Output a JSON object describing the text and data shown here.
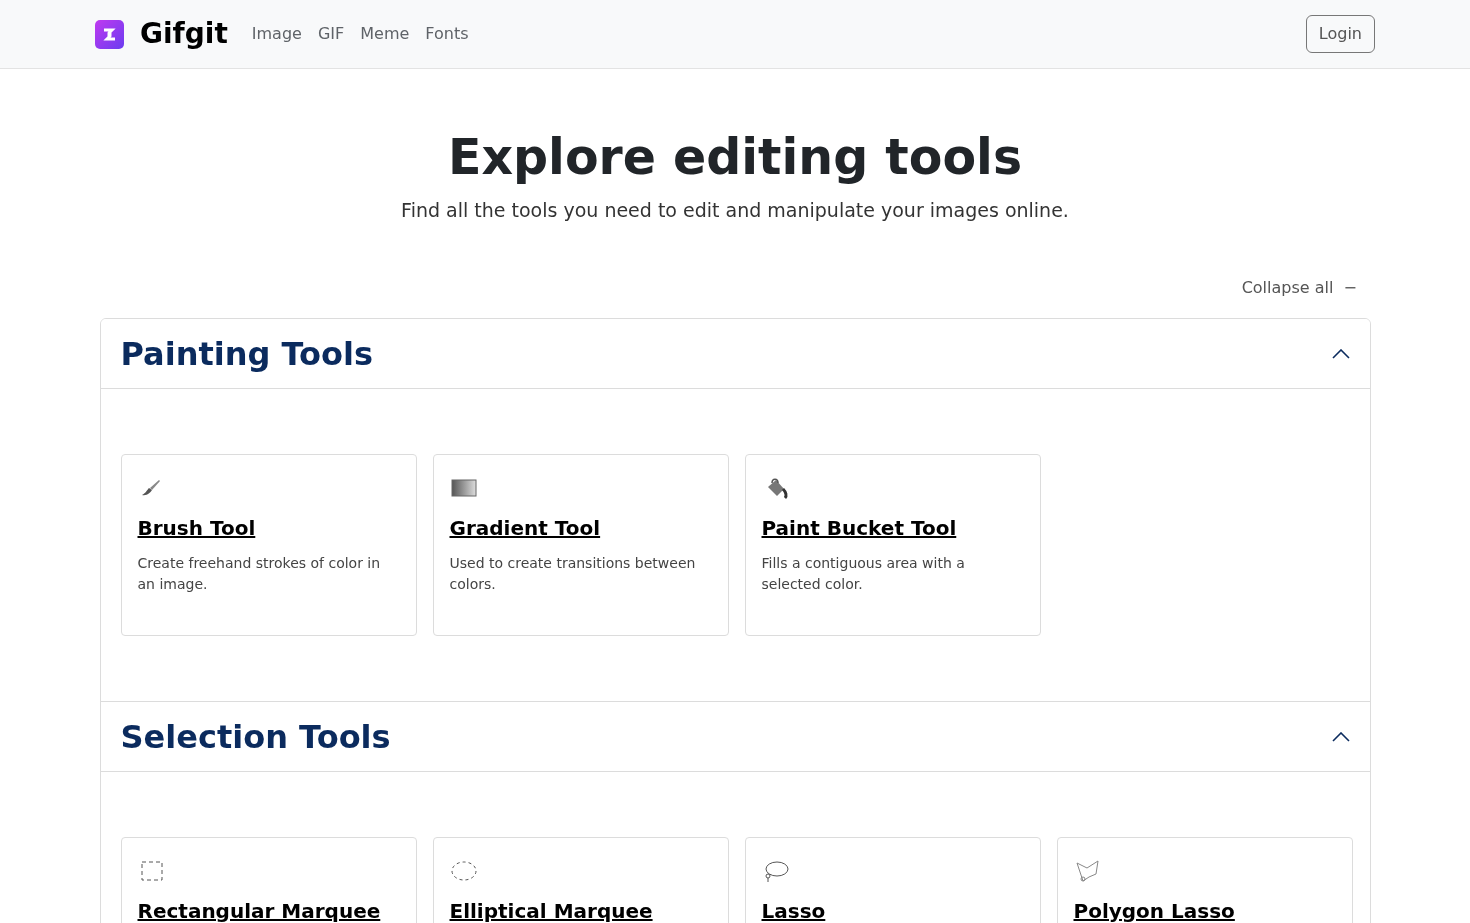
{
  "navbar": {
    "brand": "Gifgit",
    "links": [
      "Image",
      "GIF",
      "Meme",
      "Fonts"
    ],
    "login": "Login"
  },
  "hero": {
    "title": "Explore editing tools",
    "subtitle": "Find all the tools you need to edit and manipulate your images online."
  },
  "collapse_all": {
    "label": "Collapse all",
    "icon": "−"
  },
  "sections": [
    {
      "title": "Painting Tools",
      "expanded": true,
      "tools": [
        {
          "kind": "brush",
          "name": "Brush Tool",
          "description": "Create freehand strokes of color in an image."
        },
        {
          "kind": "gradient",
          "name": "Gradient Tool",
          "description": "Used to create transitions between colors."
        },
        {
          "kind": "bucket",
          "name": "Paint Bucket Tool",
          "description": "Fills a contiguous area with a selected color."
        }
      ]
    },
    {
      "title": "Selection Tools",
      "expanded": true,
      "tools": [
        {
          "kind": "rect",
          "name": "Rectangular Marquee"
        },
        {
          "kind": "ellipse",
          "name": "Elliptical Marquee"
        },
        {
          "kind": "lasso",
          "name": "Lasso"
        },
        {
          "kind": "polygon",
          "name": "Polygon Lasso"
        }
      ]
    }
  ]
}
